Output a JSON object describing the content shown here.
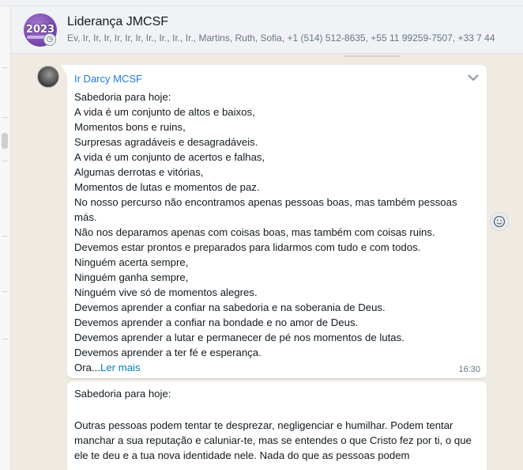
{
  "header": {
    "avatar_year": "2023",
    "title": "Liderança JMCSF",
    "members": "Ev, Ir, Ir, Ir, Ir, Ir, Ir, Ir., Ir., Ir., Ir., Martins, Ruth, Sofia, +1 (514) 512-8635, +55 11 99259-7507, +33 7 44"
  },
  "message1": {
    "sender": "Ir Darcy MCSF",
    "lines": [
      "Sabedoria para hoje:",
      "A vida é um conjunto de altos e baixos,",
      "Momentos bons e ruins,",
      "Surpresas agradáveis e desagradáveis.",
      "A vida é um conjunto de acertos e falhas,",
      "Algumas derrotas e vitórias,",
      "Momentos de lutas e momentos de paz.",
      "No nosso percurso não encontramos apenas pessoas boas, mas também pessoas más.",
      "Não nos deparamos apenas com coisas boas, mas também com coisas ruins.",
      "Devemos estar prontos e preparados para lidarmos com tudo e com todos.",
      "Ninguém acerta sempre,",
      "Ninguém ganha sempre,",
      "Ninguém vive só de momentos alegres.",
      "Devemos aprender a confiar na sabedoria e na soberania de Deus.",
      "Devemos aprender a confiar na bondade e no amor de Deus.",
      "Devemos aprender a lutar e permanecer de pé nos momentos de lutas.",
      "Devemos aprender a ter fé e esperança."
    ],
    "last_line_prefix": "Ora...",
    "read_more": "Ler mais",
    "time": "16:30"
  },
  "message2": {
    "title": "Sabedoria para hoje:",
    "body": "Outras pessoas podem tentar te desprezar, negligenciar e humilhar. Podem tentar manchar a sua reputação e caluniar-te, mas se entendes o que Cristo fez por ti, o que ele te deu e a tua nova identidade nele. Nada do que as pessoas podem"
  },
  "icons": {
    "chevron": "chevron-down-icon",
    "emoji": "emoji-icon",
    "group_badge": "community-icon"
  }
}
